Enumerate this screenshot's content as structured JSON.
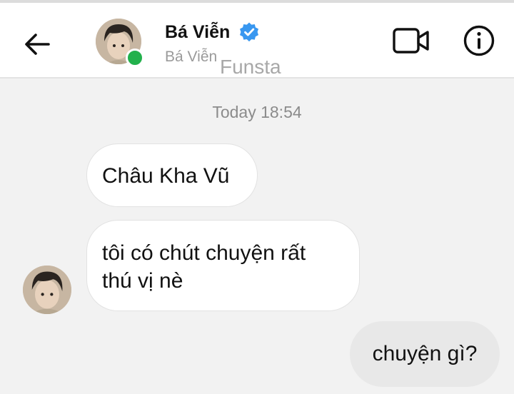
{
  "header": {
    "back_icon": "arrow-left-icon",
    "contact_name": "Bá Viễn",
    "verified_icon": "verified-badge-icon",
    "subtitle": "Bá Viễn",
    "app_watermark": "Funsta",
    "video_icon": "video-camera-icon",
    "info_icon": "info-icon",
    "online_color": "#22b14c",
    "verified_color": "#3897f0"
  },
  "chat": {
    "timestamp": "Today 18:54",
    "messages": [
      {
        "direction": "incoming",
        "lines": [
          "Châu Kha Vũ"
        ]
      },
      {
        "direction": "incoming",
        "lines": [
          "tôi có chút chuyện rất",
          "thú vị nè"
        ]
      },
      {
        "direction": "outgoing",
        "lines": [
          "chuyện gì?"
        ]
      }
    ]
  }
}
